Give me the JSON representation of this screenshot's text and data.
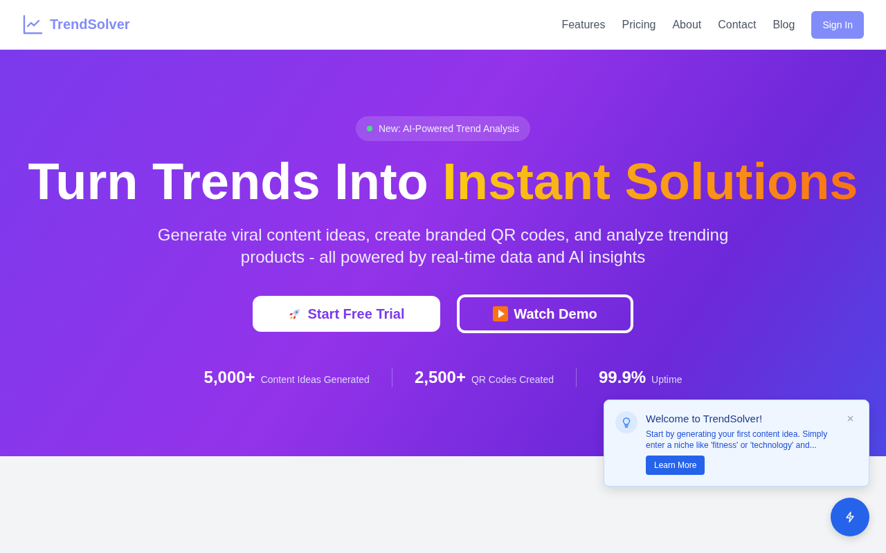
{
  "header": {
    "brand": "TrendSolver",
    "nav": [
      {
        "label": "Features"
      },
      {
        "label": "Pricing"
      },
      {
        "label": "About"
      },
      {
        "label": "Contact"
      },
      {
        "label": "Blog"
      }
    ],
    "sign_in": "Sign In"
  },
  "hero": {
    "badge": "New: AI-Powered Trend Analysis",
    "title": "Turn Trends Into",
    "title_highlight": "Instant Solutions",
    "subtitle": "Generate viral content ideas, create branded QR codes, and analyze trending products - all powered by real-time data and AI insights",
    "buttons": [
      {
        "label": "Start Free Trial",
        "kind": "primary"
      },
      {
        "label": "Watch Demo",
        "kind": "outline"
      }
    ],
    "stats": [
      {
        "value": "5,000+",
        "label": "Content Ideas Generated"
      },
      {
        "value": "2,500+",
        "label": "QR Codes Created"
      },
      {
        "value": "99.9%",
        "label": "Uptime"
      }
    ]
  },
  "toast": {
    "title": "Welcome to TrendSolver!",
    "message": "Start by generating your first content idea. Simply enter a niche like 'fitness' or 'technology' and...",
    "action": "Learn More"
  }
}
